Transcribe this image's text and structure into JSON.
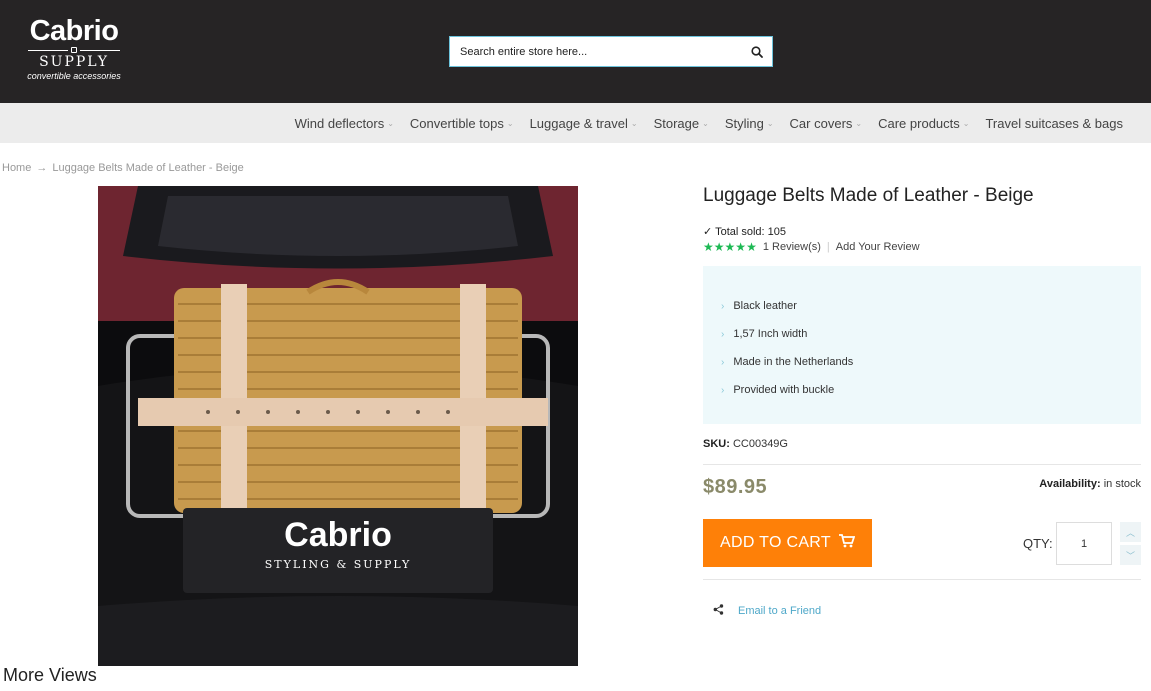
{
  "header": {
    "logo": {
      "main": "Cabrio",
      "sub": "SUPPLY",
      "tagline": "convertible accessories"
    },
    "search": {
      "placeholder": "Search entire store here..."
    }
  },
  "nav": {
    "items": [
      {
        "label": "Wind deflectors",
        "has_dropdown": true
      },
      {
        "label": "Convertible tops",
        "has_dropdown": true
      },
      {
        "label": "Luggage & travel",
        "has_dropdown": true
      },
      {
        "label": "Storage",
        "has_dropdown": true
      },
      {
        "label": "Styling",
        "has_dropdown": true
      },
      {
        "label": "Car covers",
        "has_dropdown": true
      },
      {
        "label": "Care products",
        "has_dropdown": true
      },
      {
        "label": "Travel suitcases & bags",
        "has_dropdown": false
      }
    ]
  },
  "breadcrumb": {
    "home": "Home",
    "current": "Luggage Belts Made of Leather - Beige"
  },
  "image": {
    "plate_main": "Cabrio",
    "plate_sub": "STYLING & SUPPLY"
  },
  "more_views": "More Views",
  "product": {
    "title": "Luggage Belts Made of Leather - Beige",
    "total_sold_label": "✓ Total sold:",
    "total_sold": "105",
    "rating": 5,
    "reviews_label": "1 Review(s)",
    "add_review_label": "Add Your Review",
    "features": [
      "Black leather",
      "1,57 Inch width",
      "Made in the Netherlands",
      "Provided with buckle"
    ],
    "sku_label": "SKU:",
    "sku": "CC00349G",
    "price": "$89.95",
    "availability_label": "Availability:",
    "availability": "in stock",
    "add_to_cart_label": "ADD TO CART",
    "qty_label": "QTY:",
    "qty": "1",
    "email_friend_label": "Email to a Friend"
  },
  "colors": {
    "header_bg": "#262425",
    "nav_bg": "#ececec",
    "accent": "#fe8008",
    "link": "#4fa8c9",
    "stars": "#1db954",
    "feature_bg": "#eef9fb"
  }
}
